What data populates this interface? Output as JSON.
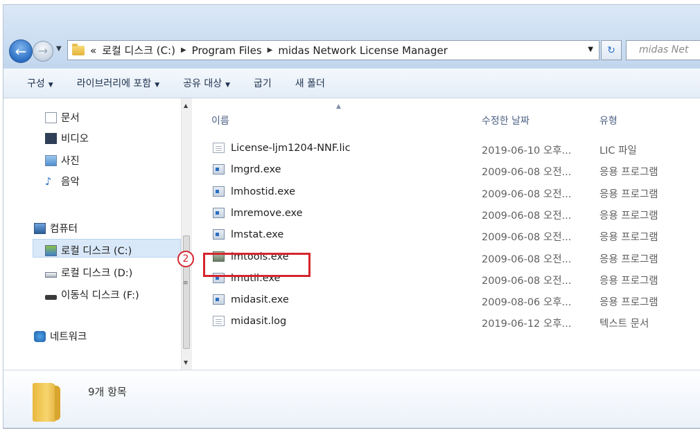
{
  "address": {
    "overflow": "«",
    "crumbs": [
      "로컬 디스크 (C:)",
      "Program Files",
      "midas Network License Manager"
    ],
    "search_placeholder": "midas Net"
  },
  "toolbar": {
    "items": [
      "구성",
      "라이브러리에 포함",
      "공유 대상",
      "굽기",
      "새 폴더"
    ]
  },
  "nav": {
    "items": [
      "문서",
      "비디오",
      "사진",
      "음악",
      "컴퓨터",
      "로컬 디스크 (C:)",
      "로컬 디스크 (D:)",
      "이동식 디스크 (F:)",
      "네트워크"
    ],
    "selected": "로컬 디스크 (C:)"
  },
  "columns": {
    "name": "이름",
    "date": "수정한 날짜",
    "type": "유형"
  },
  "files": [
    {
      "name": "License-ljm1204-NNF.lic",
      "date": "2019-06-10 오후...",
      "type": "LIC 파일",
      "icon": "document-icon"
    },
    {
      "name": "lmgrd.exe",
      "date": "2009-06-08 오전...",
      "type": "응용 프로그램",
      "icon": "exe-icon"
    },
    {
      "name": "lmhostid.exe",
      "date": "2009-06-08 오전...",
      "type": "응용 프로그램",
      "icon": "exe-icon"
    },
    {
      "name": "lmremove.exe",
      "date": "2009-06-08 오전...",
      "type": "응용 프로그램",
      "icon": "exe-icon"
    },
    {
      "name": "lmstat.exe",
      "date": "2009-06-08 오전...",
      "type": "응용 프로그램",
      "icon": "exe-icon"
    },
    {
      "name": "lmtools.exe",
      "date": "2009-06-08 오전...",
      "type": "응용 프로그램",
      "icon": "tools-exe-icon"
    },
    {
      "name": "lmutil.exe",
      "date": "2009-06-08 오전...",
      "type": "응용 프로그램",
      "icon": "exe-icon"
    },
    {
      "name": "midasit.exe",
      "date": "2009-08-06 오후...",
      "type": "응용 프로그램",
      "icon": "exe-icon"
    },
    {
      "name": "midasit.log",
      "date": "2019-06-12 오후...",
      "type": "텍스트 문서",
      "icon": "document-icon"
    }
  ],
  "annotation": {
    "step": "2",
    "color": "#d5252c"
  },
  "details": {
    "count": "9개 항목"
  }
}
